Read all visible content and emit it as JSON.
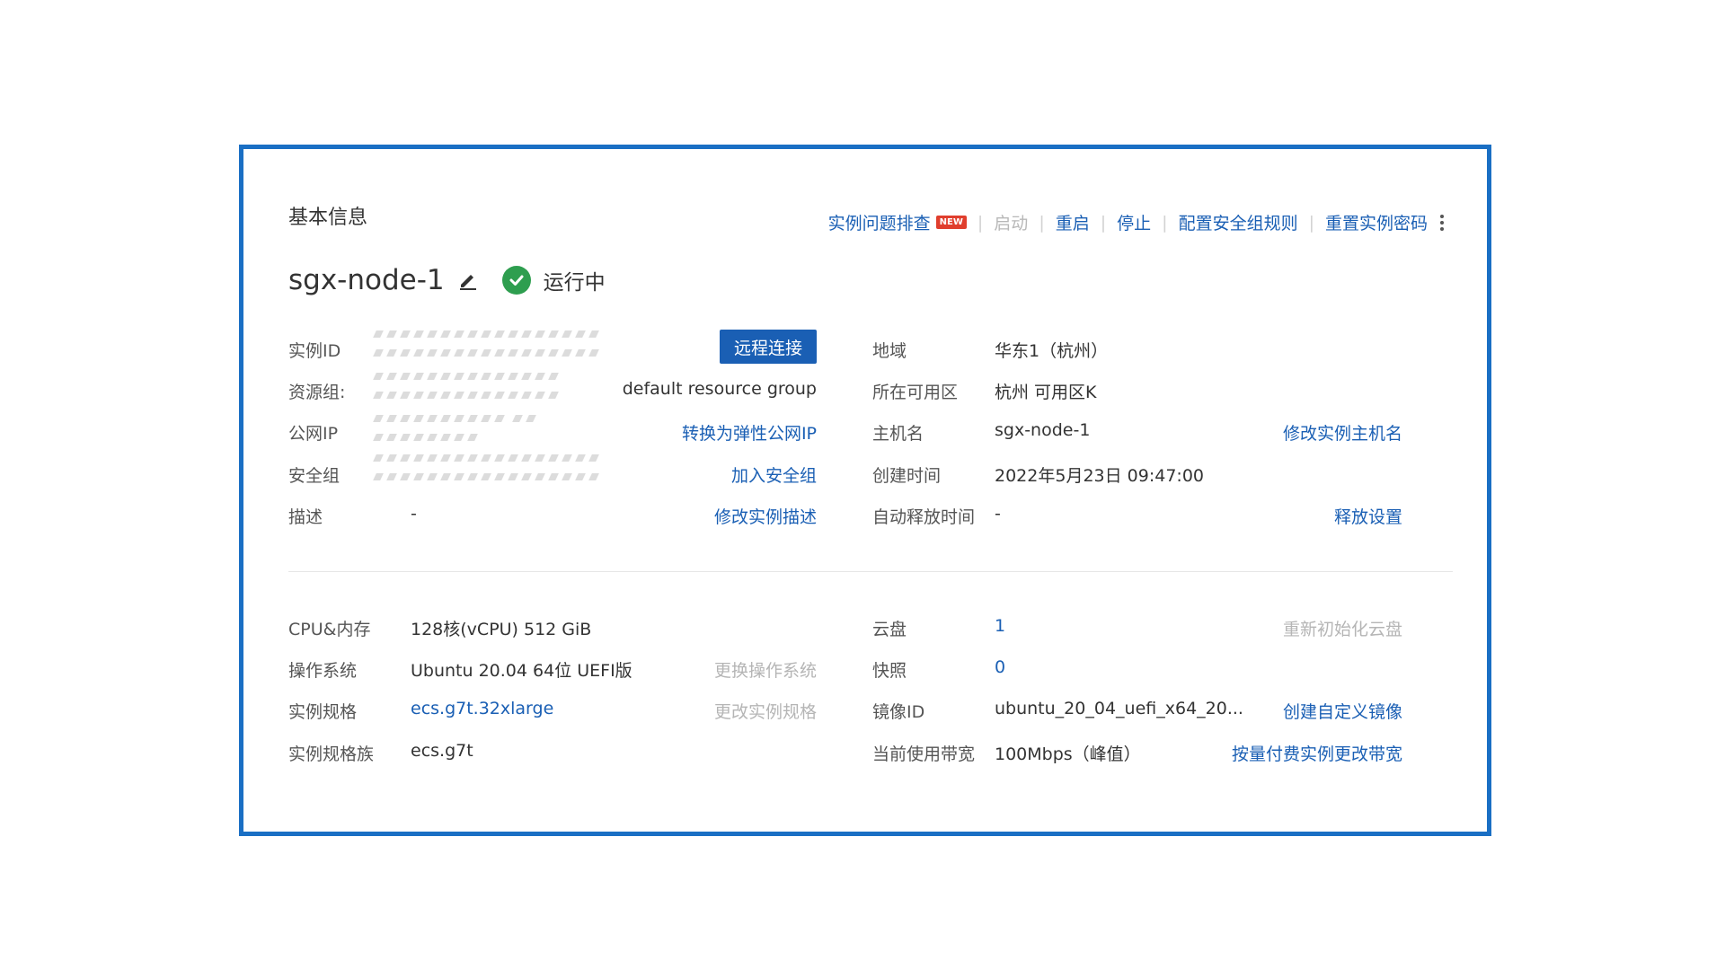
{
  "section_title": "基本信息",
  "toolbar": {
    "troubleshoot": "实例问题排查",
    "new_badge": "NEW",
    "start": "启动",
    "restart": "重启",
    "stop": "停止",
    "config_security_rules": "配置安全组规则",
    "reset_password": "重置实例密码",
    "separator": "|"
  },
  "instance": {
    "name": "sgx-node-1",
    "status": "运行中",
    "status_color": "#2e9e4f"
  },
  "basic": {
    "instance_id_label": "实例ID",
    "remote_connect": "远程连接",
    "resource_group_label": "资源组:",
    "resource_group_value": "default resource group",
    "public_ip_label": "公网IP",
    "convert_eip": "转换为弹性公网IP",
    "security_group_label": "安全组",
    "join_security_group": "加入安全组",
    "description_label": "描述",
    "description_value": "-",
    "modify_description": "修改实例描述",
    "region_label": "地域",
    "region_value": "华东1（杭州）",
    "zone_label": "所在可用区",
    "zone_value": "杭州 可用区K",
    "hostname_label": "主机名",
    "hostname_value": "sgx-node-1",
    "modify_hostname": "修改实例主机名",
    "created_label": "创建时间",
    "created_value": "2022年5月23日 09:47:00",
    "auto_release_label": "自动释放时间",
    "auto_release_value": "-",
    "release_settings": "释放设置"
  },
  "config": {
    "cpu_mem_label": "CPU&内存",
    "cpu_mem_value": "128核(vCPU) 512 GiB",
    "os_label": "操作系统",
    "os_value": "Ubuntu 20.04 64位 UEFI版",
    "change_os": "更换操作系统",
    "spec_label": "实例规格",
    "spec_value": "ecs.g7t.32xlarge",
    "change_spec": "更改实例规格",
    "spec_family_label": "实例规格族",
    "spec_family_value": "ecs.g7t",
    "disk_label": "云盘",
    "disk_value": "1",
    "reinit_disk": "重新初始化云盘",
    "snapshot_label": "快照",
    "snapshot_value": "0",
    "image_id_label": "镜像ID",
    "image_id_value": "ubuntu_20_04_uefi_x64_20...",
    "create_custom_image": "创建自定义镜像",
    "bandwidth_label": "当前使用带宽",
    "bandwidth_value": "100Mbps（峰值）",
    "change_bandwidth": "按量付费实例更改带宽"
  },
  "colors": {
    "accent": "#1a5fb4",
    "frame": "#1a6fc4",
    "new_badge": "#e03e2d"
  }
}
